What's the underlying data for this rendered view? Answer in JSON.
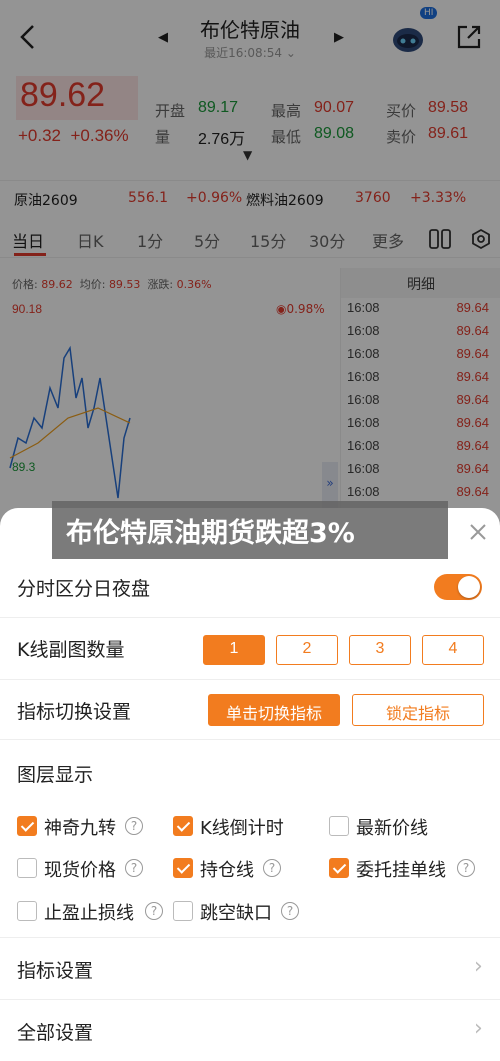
{
  "header": {
    "title": "布伦特原油",
    "subtitle": "最近16:08:54 ⌄",
    "badge": "HI"
  },
  "quote": {
    "price": "89.62",
    "change": "+0.32",
    "change_pct": "+0.36%",
    "open_label": "开盘",
    "open": "89.17",
    "high_label": "最高",
    "high": "90.07",
    "bid_label": "买价",
    "bid": "89.58",
    "volume_label": "量",
    "volume": "2.76万",
    "low_label": "最低",
    "low": "89.08",
    "ask_label": "卖价",
    "ask": "89.61"
  },
  "related": {
    "name1": "原油2609",
    "price1": "556.1",
    "pct1": "+0.96%",
    "name2": "燃料油2609",
    "price2": "3760",
    "pct2": "+3.33%"
  },
  "tabs": [
    "当日",
    "日K",
    "1分",
    "5分",
    "15分",
    "30分",
    "更多"
  ],
  "chart": {
    "info_price_label": "价格:",
    "info_price": "89.62",
    "info_avg_label": "均价:",
    "info_avg": "89.53",
    "info_chg_label": "涨跌:",
    "info_chg": "0.36%",
    "y_top": "90.18",
    "y_low": "89.3",
    "pct_label": "0.98%"
  },
  "detail": {
    "header": "明细",
    "rows": [
      {
        "time": "16:08",
        "price": "89.64"
      },
      {
        "time": "16:08",
        "price": "89.64"
      },
      {
        "time": "16:08",
        "price": "89.64"
      },
      {
        "time": "16:08",
        "price": "89.64"
      },
      {
        "time": "16:08",
        "price": "89.64"
      },
      {
        "time": "16:08",
        "price": "89.64"
      },
      {
        "time": "16:08",
        "price": "89.64"
      },
      {
        "time": "16:08",
        "price": "89.64"
      },
      {
        "time": "16:08",
        "price": "89.64"
      }
    ]
  },
  "headline": "布伦特原油期货跌超3%",
  "sheet": {
    "night_label": "分时区分日夜盘",
    "night_on": true,
    "sub_chart_label": "K线副图数量",
    "sub_chart_options": [
      "1",
      "2",
      "3",
      "4"
    ],
    "indicator_switch_label": "指标切换设置",
    "indicator_click": "单击切换指标",
    "indicator_lock": "锁定指标",
    "layers_title": "图层显示",
    "layers": [
      {
        "label": "神奇九转",
        "checked": true
      },
      {
        "label": "K线倒计时",
        "checked": true
      },
      {
        "label": "最新价线",
        "checked": false
      },
      {
        "label": "现货价格",
        "checked": false
      },
      {
        "label": "持仓线",
        "checked": true
      },
      {
        "label": "委托挂单线",
        "checked": true
      },
      {
        "label": "止盈止损线",
        "checked": false
      },
      {
        "label": "跳空缺口",
        "checked": false
      }
    ],
    "indicator_settings": "指标设置",
    "all_settings": "全部设置"
  }
}
